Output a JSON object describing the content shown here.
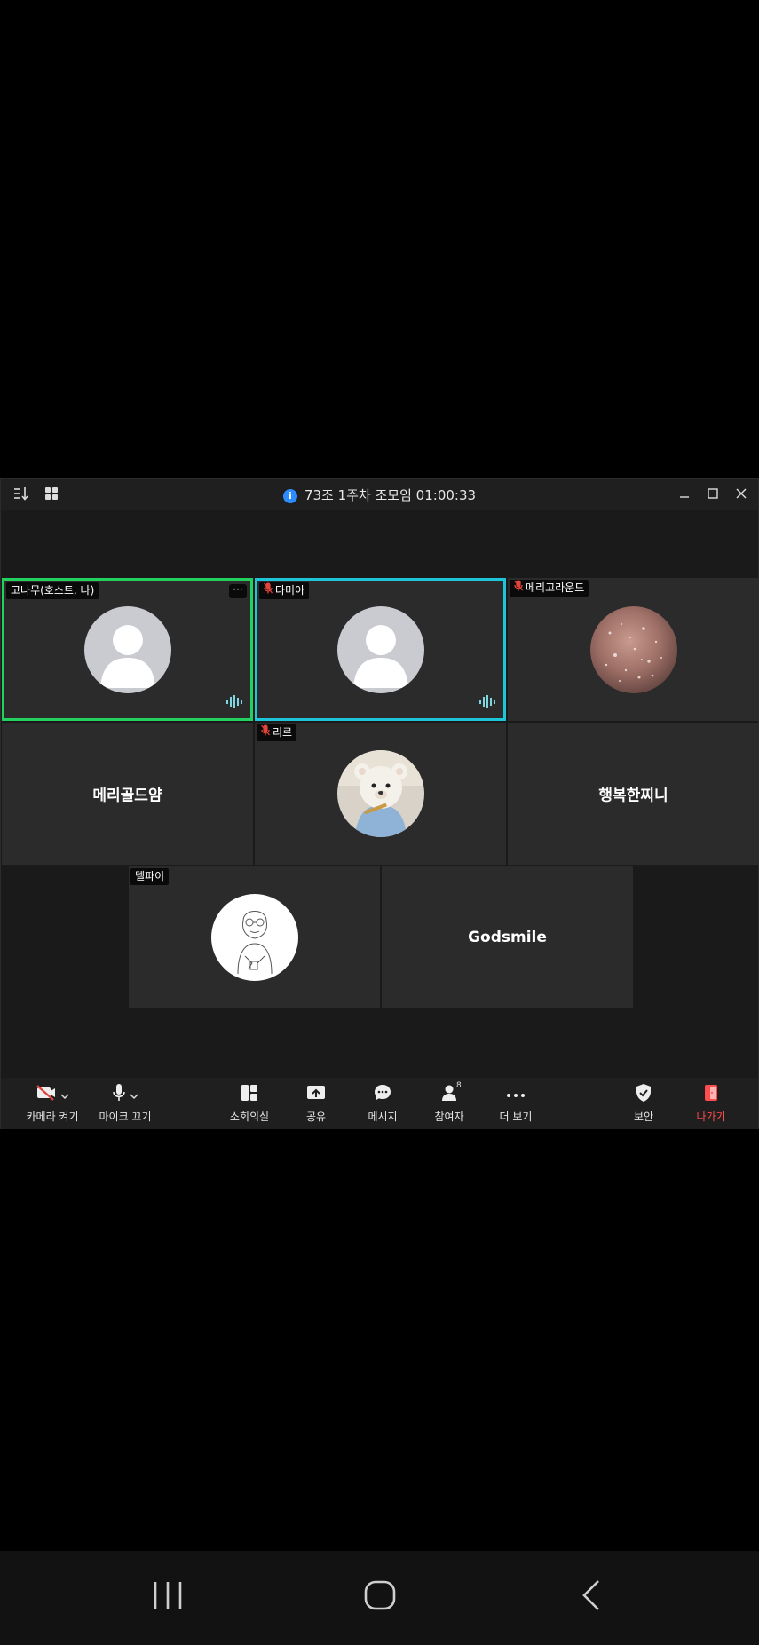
{
  "window": {
    "title": "73조 1주차 조모임 01:00:33",
    "info_icon": "info-icon"
  },
  "tiles": [
    {
      "label": "고나무(호스트, 나)",
      "muted": false,
      "kind": "avatar-default",
      "active": "green",
      "speaking": true,
      "more": "···"
    },
    {
      "label": "다미아",
      "muted": true,
      "kind": "avatar-default",
      "active": "teal",
      "speaking": true
    },
    {
      "label": "메리고라운드",
      "muted": true,
      "kind": "avatar-photo-glitter"
    },
    {
      "name": "메리골드얌",
      "kind": "name-only"
    },
    {
      "label": "리르",
      "muted": true,
      "kind": "avatar-photo-bear"
    },
    {
      "name": "행복한찌니",
      "kind": "name-only"
    },
    {
      "label": "델파이",
      "muted": false,
      "kind": "avatar-sketch"
    },
    {
      "name": "Godsmile",
      "kind": "name-only"
    }
  ],
  "toolbar": {
    "camera": "카메라 켜기",
    "mic": "마이크 끄기",
    "breakout": "소회의실",
    "share": "공유",
    "chat": "메시지",
    "participants": "참여자",
    "participants_count": "8",
    "more": "더 보기",
    "security": "보안",
    "leave": "나가기"
  },
  "colors": {
    "active_green": "#23d160",
    "active_teal": "#1ec5d8",
    "leave_red": "#ff4d4d",
    "muted_red": "#e0443b",
    "info_blue": "#2d8cff"
  }
}
